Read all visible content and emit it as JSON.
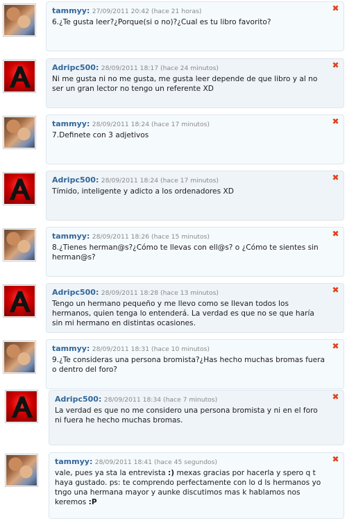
{
  "comments": [
    {
      "author": "tammyy:",
      "meta": "27/09/2011 20:42 (hace 21 horas)",
      "text": "6.¿Te gusta leer?¿Porque(si o no)?¿Cual es tu libro favorito?",
      "delete": "✖"
    },
    {
      "author": "Adripc500:",
      "meta": "28/09/2011 18:17 (hace 24 minutos)",
      "text": "Ni me gusta ni no me gusta, me gusta leer depende de que libro y al no ser un gran lector no tengo un referente XD",
      "delete": "✖"
    },
    {
      "author": "tammyy:",
      "meta": "28/09/2011 18:24 (hace 17 minutos)",
      "text": "7.Definete con 3 adjetivos",
      "delete": "✖"
    },
    {
      "author": "Adripc500:",
      "meta": "28/09/2011 18:24 (hace 17 minutos)",
      "text": "Tímido, inteligente y adicto a los ordenadores XD",
      "delete": "✖"
    },
    {
      "author": "tammyy:",
      "meta": "28/09/2011 18:26 (hace 15 minutos)",
      "text": "8.¿Tienes herman@s?¿Cómo te llevas con ell@s? o ¿Cómo te sientes sin herman@s?",
      "delete": "✖"
    },
    {
      "author": "Adripc500:",
      "meta": "28/09/2011 18:28 (hace 13 minutos)",
      "text": "Tengo un hermano pequeño y me llevo como se llevan todos los hermanos, quien tenga lo entenderá. La verdad es que no se que haría sin mi hermano en distintas ocasiones.",
      "delete": "✖"
    },
    {
      "author": "tammyy:",
      "meta": "28/09/2011 18:31 (hace 10 minutos)",
      "text": "9.¿Te consideras una persona bromista?¿Has hecho muchas bromas fuera o dentro del foro?",
      "delete": "✖"
    },
    {
      "author": "Adripc500:",
      "meta": "28/09/2011 18:34 (hace 7 minutos)",
      "text": "La verdad es que no me considero una persona bromista y ni en el foro ni fuera he hecho muchas bromas.",
      "delete": "✖"
    },
    {
      "author": "tammyy:",
      "meta": "28/09/2011 18:41 (hace 45 segundos)",
      "text_before": "vale, pues ya sta la entrevista ",
      "smiley": ":)",
      "text_after": " mexas gracias por hacerla y spero q t haya gustado. ps: te comprendo perfectamente con lo d ls hermanos yo tngo una hermana mayor y aunke discutimos mas k hablamos nos keremos ",
      "smiley2": ":P",
      "delete": "✖"
    }
  ]
}
